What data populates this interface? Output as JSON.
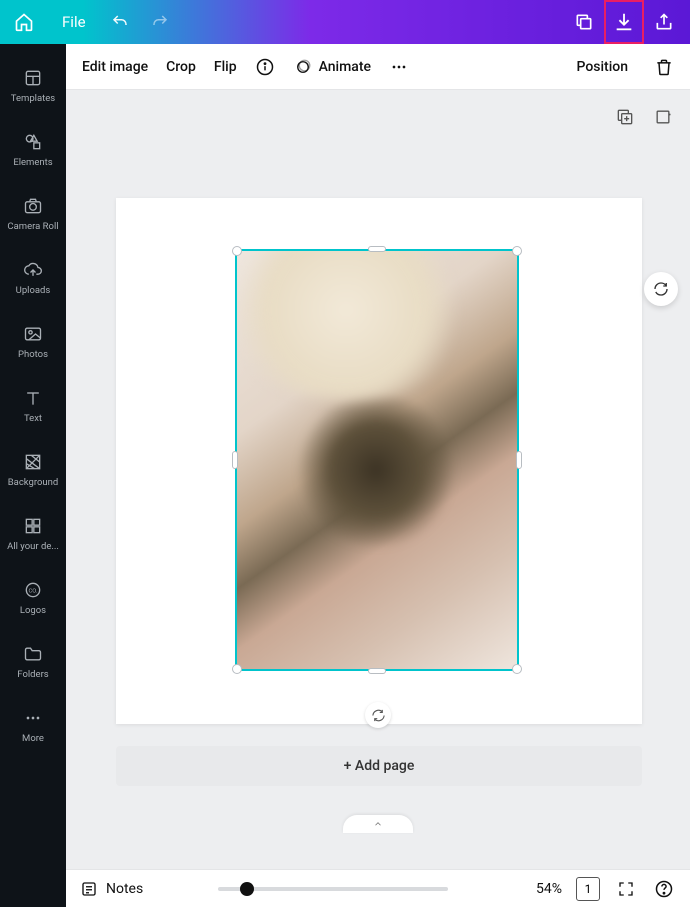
{
  "topBar": {
    "file": "File"
  },
  "sidebar": {
    "items": [
      {
        "label": "Templates"
      },
      {
        "label": "Elements"
      },
      {
        "label": "Camera Roll"
      },
      {
        "label": "Uploads"
      },
      {
        "label": "Photos"
      },
      {
        "label": "Text"
      },
      {
        "label": "Background"
      },
      {
        "label": "All your de..."
      },
      {
        "label": "Logos"
      },
      {
        "label": "Folders"
      },
      {
        "label": "More"
      }
    ]
  },
  "imageToolbar": {
    "editImage": "Edit image",
    "crop": "Crop",
    "flip": "Flip",
    "animate": "Animate",
    "position": "Position"
  },
  "canvas": {
    "addPage": "+ Add page"
  },
  "bottomBar": {
    "notes": "Notes",
    "zoom": "54%",
    "pageNumber": "1"
  }
}
